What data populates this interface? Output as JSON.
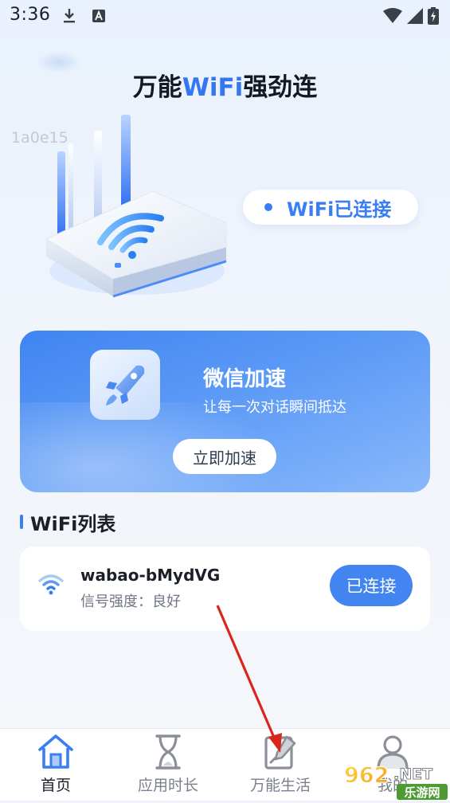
{
  "status_bar": {
    "time": "3:36",
    "download_icon": "download-icon",
    "notification_icon": "a-letter-icon",
    "wifi_icon": "wifi-signal-icon",
    "cell_icon": "cell-signal-icon",
    "battery_icon": "battery-charging-icon"
  },
  "header": {
    "title_prefix": "万能",
    "title_accent": "WiFi",
    "title_suffix": "强劲连",
    "device_id": "1a0e15"
  },
  "connection": {
    "status_text": "WiFi已连接"
  },
  "promo": {
    "title": "微信加速",
    "subtitle": "让每一次对话瞬间抵达",
    "button_label": "立即加速",
    "icon": "rocket-icon"
  },
  "wifi_list": {
    "section_title": "WiFi列表",
    "items": [
      {
        "name": "wabao-bMydVG",
        "signal": "信号强度：良好",
        "action_label": "已连接",
        "icon": "wifi-icon"
      }
    ]
  },
  "bottom_nav": {
    "items": [
      {
        "label": "首页",
        "icon": "home-icon",
        "active": true
      },
      {
        "label": "应用时长",
        "icon": "hourglass-icon",
        "active": false
      },
      {
        "label": "万能生活",
        "icon": "tablet-pen-icon",
        "active": false
      },
      {
        "label": "我的",
        "icon": "profile-icon",
        "active": false
      }
    ]
  },
  "watermark": {
    "text": "962.NET",
    "sub_text": "乐游网"
  },
  "colors": {
    "accent": "#3a7ef3",
    "card_gradient_start": "#3f84f1",
    "card_gradient_end": "#8ab8fb",
    "annotation_arrow": "#d9261c"
  }
}
